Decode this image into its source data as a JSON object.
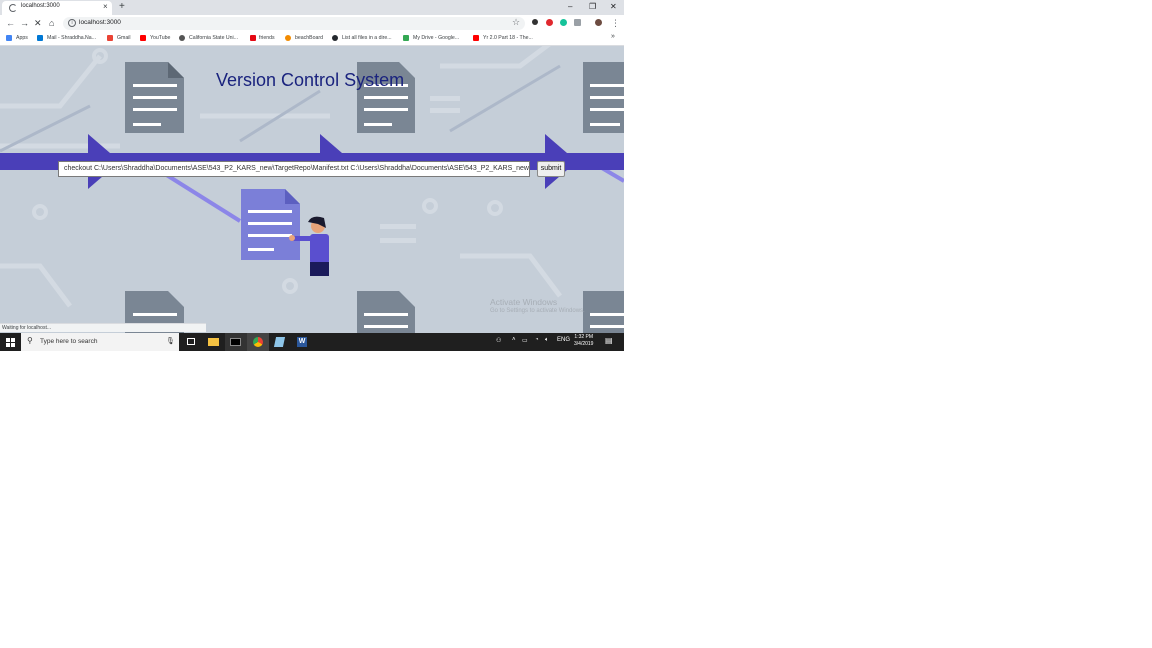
{
  "browser": {
    "tab_title": "localhost:3000",
    "new_tab": "+",
    "tab_close": "×",
    "url": "localhost:3000",
    "window_controls": [
      "–",
      "❐",
      "✕"
    ],
    "bookmarks": [
      {
        "label": "Apps",
        "icon": "apps-grid-icon",
        "color": "#4285f4"
      },
      {
        "label": "Mail - Shraddha.Na...",
        "icon": "outlook-icon",
        "color": "#0078d4"
      },
      {
        "label": "Gmail",
        "icon": "gmail-icon",
        "color": "#ea4335"
      },
      {
        "label": "YouTube",
        "icon": "youtube-icon",
        "color": "#ff0000"
      },
      {
        "label": "California State Uni...",
        "icon": "globe-icon",
        "color": "#555555"
      },
      {
        "label": "friends",
        "icon": "netflix-icon",
        "color": "#e50914"
      },
      {
        "label": "beachBoard",
        "icon": "beachboard-icon",
        "color": "#f28b00"
      },
      {
        "label": "List all files in a dire...",
        "icon": "github-icon",
        "color": "#24292e"
      },
      {
        "label": "My Drive - Google...",
        "icon": "drive-icon",
        "color": "#34a853"
      },
      {
        "label": "Yr 2.0 Part 18 - The...",
        "icon": "youtube-icon",
        "color": "#ff0000"
      }
    ],
    "bookmarks_overflow": "»",
    "status_text": "Waiting for localhost..."
  },
  "page": {
    "title": "Version Control System",
    "command_value": "checkout C:\\Users\\Shraddha\\Documents\\ASE\\543_P2_KARS_new\\TargetRepo\\Manifest.txt C:\\Users\\Shraddha\\Documents\\ASE\\543_P2_KARS_new",
    "submit_label": "submit",
    "watermark_line1": "Activate Windows",
    "watermark_line2": "Go to Settings to activate Windows.",
    "colors": {
      "background": "#c5ced8",
      "heading": "#1a237e",
      "band": "#4a3fb8",
      "doc": "#7b7fd8"
    }
  },
  "taskbar": {
    "search_placeholder": "Type here to search",
    "language": "ENG",
    "time": "1:32 PM",
    "date": "3/4/2019"
  }
}
